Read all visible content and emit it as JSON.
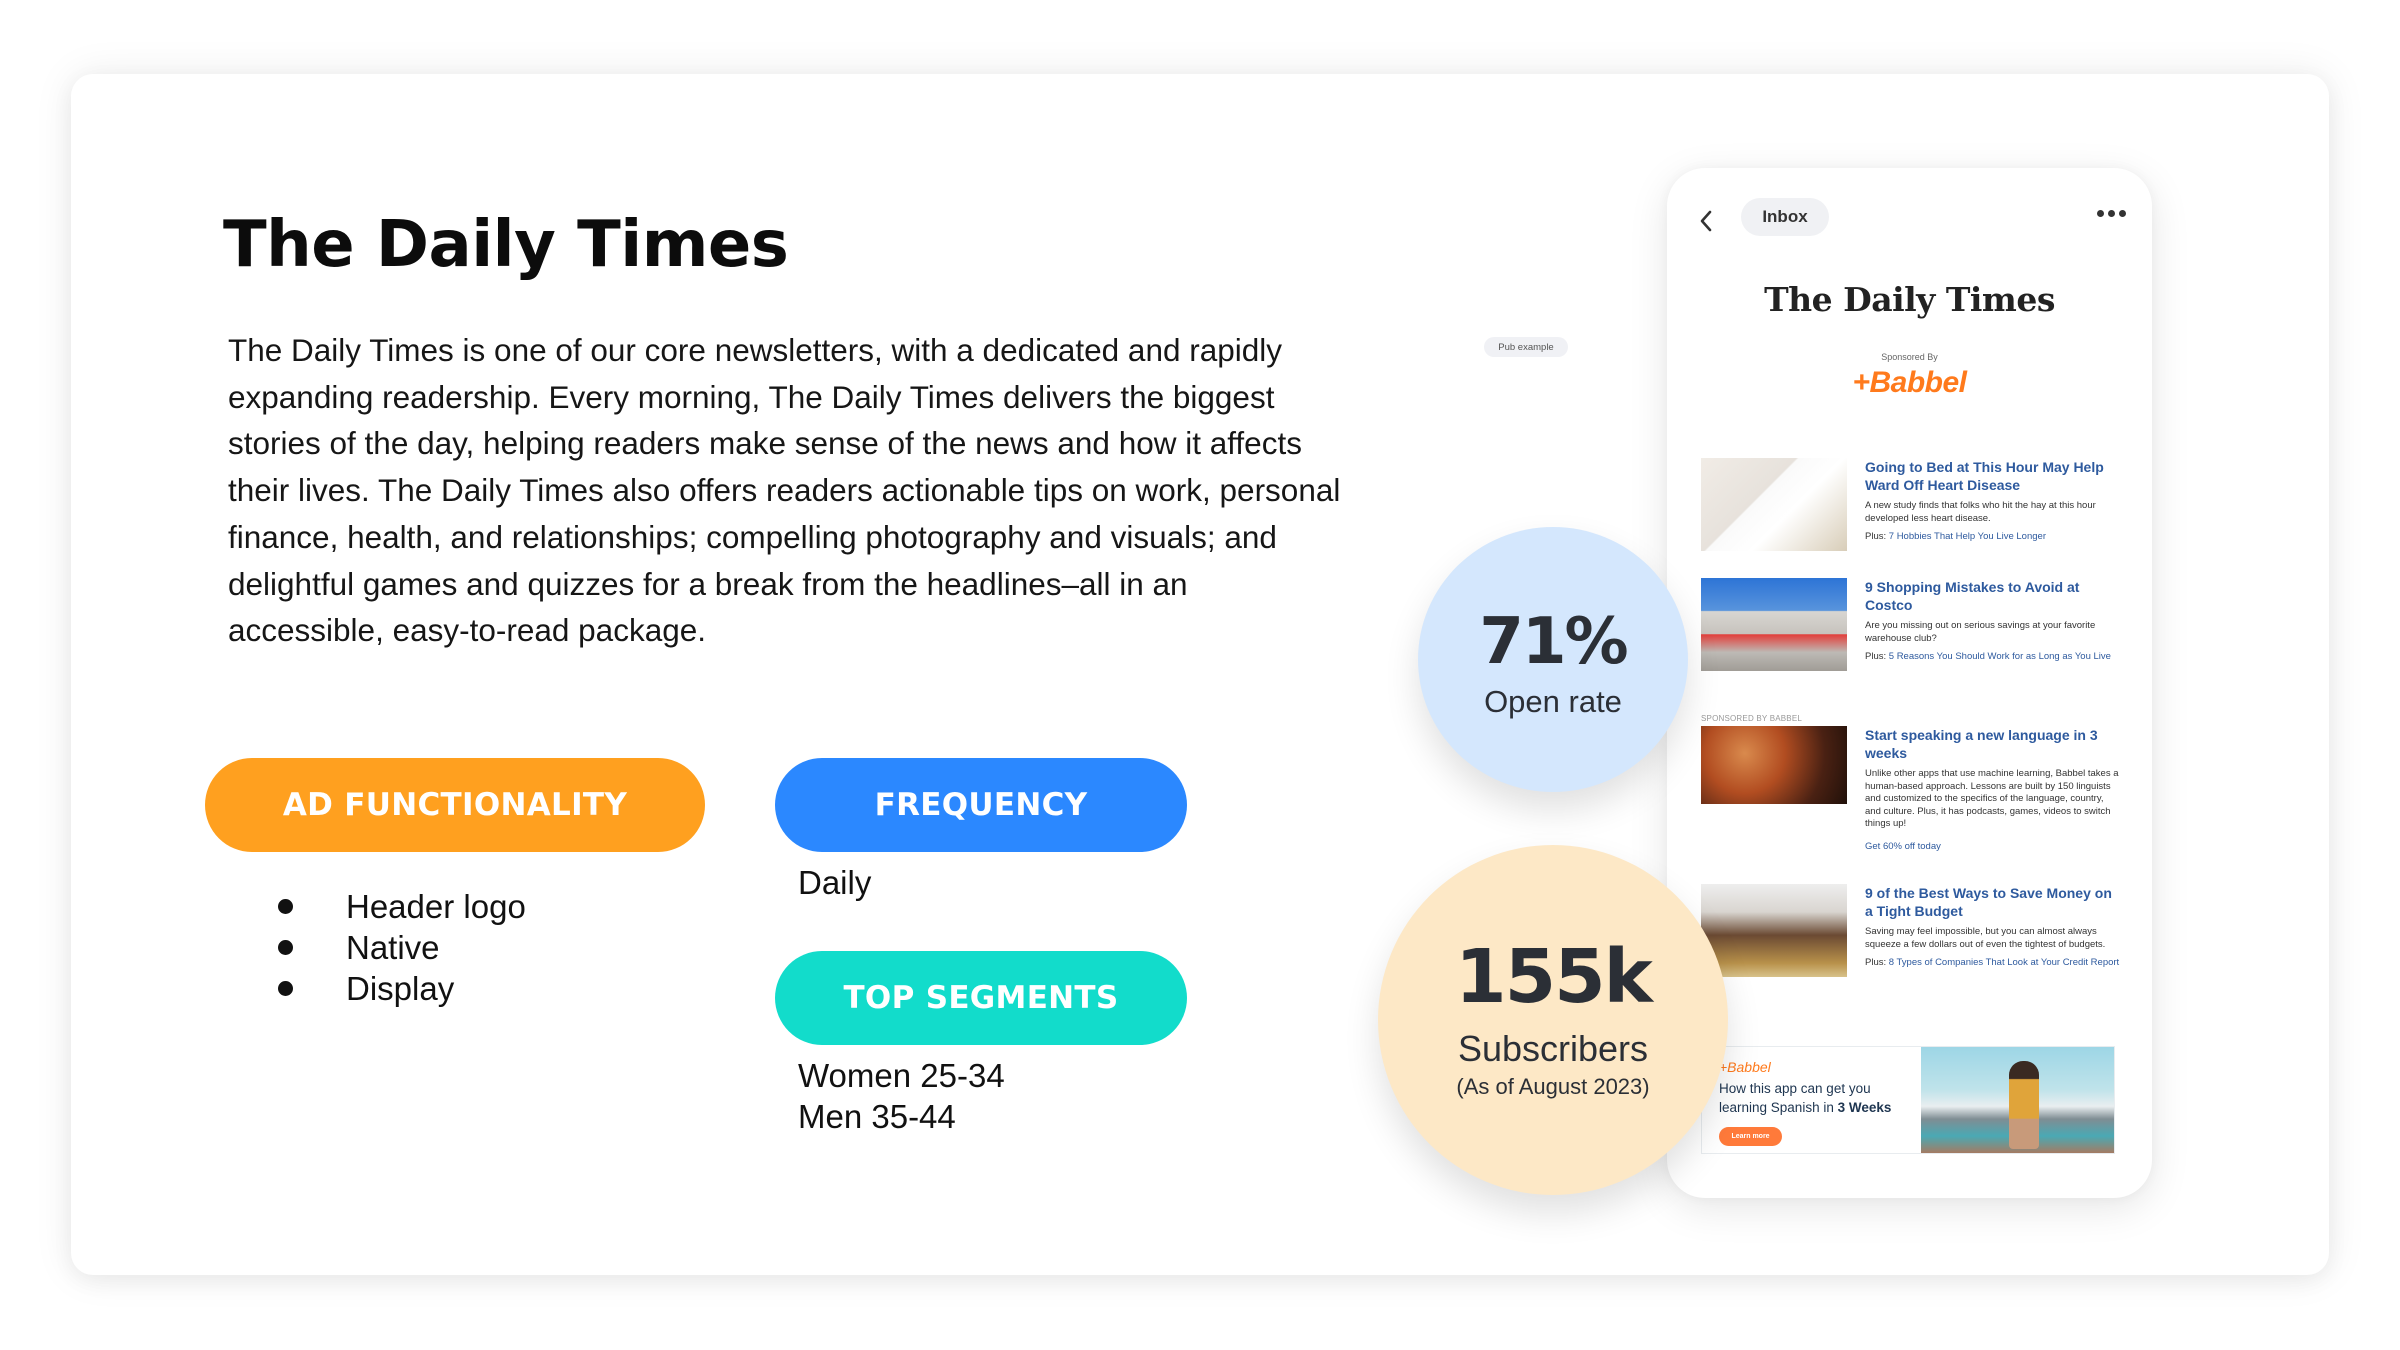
{
  "slide": {
    "title": "The Daily Times",
    "description": "The Daily Times is one of our core newsletters, with a dedicated and rapidly expanding readership. Every morning, The Daily Times delivers the biggest stories of the day, helping readers make sense of the news and how it affects their lives. The Daily Times also offers readers actionable tips on work, personal finance, health, and relationships; compelling photography and visuals; and delightful games and quizzes for a break from the headlines–all in an accessible, easy-to-read package.",
    "ad_functionality": {
      "label": "AD FUNCTIONALITY",
      "color": "#FFA01F",
      "items": [
        "Header logo",
        "Native",
        "Display"
      ]
    },
    "frequency": {
      "label": "FREQUENCY",
      "color": "#2B88FF",
      "value": "Daily"
    },
    "top_segments": {
      "label": "TOP SEGMENTS",
      "color": "#12DCCB",
      "items": [
        "Women 25-34",
        "Men 35-44"
      ]
    },
    "pub_example_label": "Pub example"
  },
  "stats": {
    "open_rate": {
      "value": "71%",
      "label": "Open rate",
      "color": "#D4E7FD"
    },
    "subscribers": {
      "value": "155k",
      "label": "Subscribers",
      "note": "(As of August 2023)",
      "color": "#FDE8C6"
    }
  },
  "phone": {
    "back_icon": "chevron-left-icon",
    "inbox_label": "Inbox",
    "more_icon": "more-horizontal-icon",
    "newsletter_logo": "The Daily Times",
    "sponsored_by": "Sponsored By",
    "sponsor_logo": "+Babbel",
    "sponsored_section_label": "SPONSORED BY BABBEL",
    "articles": [
      {
        "headline": "Going to Bed at This Hour May Help Ward Off Heart Disease",
        "summary": "A new study finds that folks who hit the hay at this hour developed less heart disease.",
        "plus_label": "Plus:",
        "plus_link": "7 Hobbies That Help You Live Longer"
      },
      {
        "headline": "9 Shopping Mistakes to Avoid at Costco",
        "summary": "Are you missing out on serious savings at your favorite warehouse club?",
        "plus_label": "Plus:",
        "plus_link": "5 Reasons You Should Work for as Long as You Live"
      },
      {
        "headline": "Start speaking a new language in 3 weeks",
        "summary": "Unlike other apps that use machine learning, Babbel takes a human-based approach. Lessons are built by 150 linguists and customized to the specifics of the language, country, and culture. Plus, it has podcasts, games, videos to switch things up!",
        "cta": "Get 60% off today"
      },
      {
        "headline": "9 of the Best Ways to Save Money on a Tight Budget",
        "summary": "Saving may feel impossible, but you can almost always squeeze a few dollars out of even the tightest of budgets.",
        "plus_label": "Plus:",
        "plus_link": "8 Types of Companies That Look at Your Credit Report"
      }
    ],
    "display_ad": {
      "brand": "+Babbel",
      "copy_prefix": "How this app can get you learning Spanish in ",
      "copy_bold": "3 Weeks",
      "button": "Learn more"
    }
  }
}
